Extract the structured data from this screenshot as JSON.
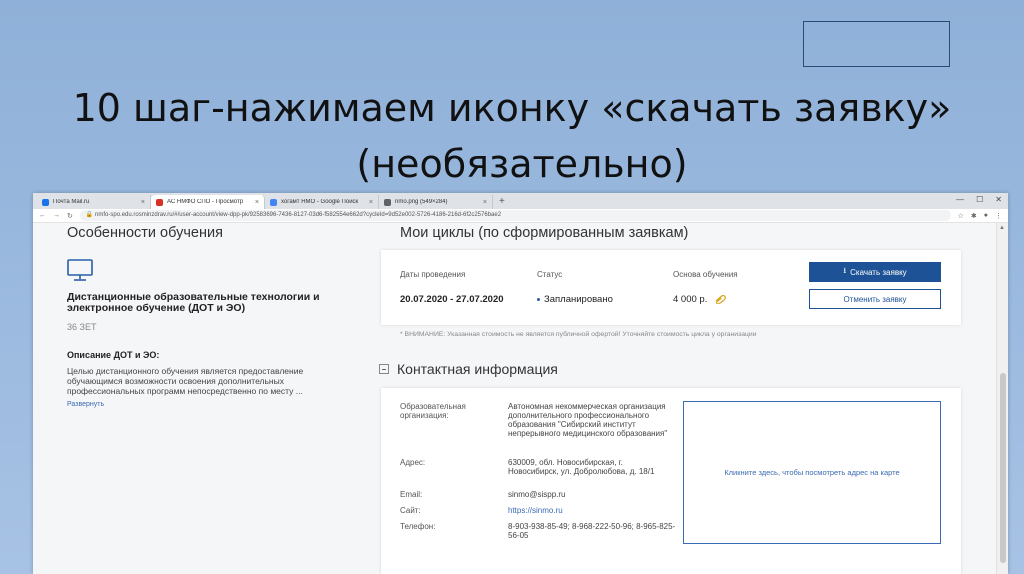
{
  "slide": {
    "title_line1": "10 шаг-нажимаем иконку «скачать заявку»",
    "title_line2": "(необязательно)"
  },
  "browser": {
    "tabs": [
      {
        "label": "Почта Mail.ru",
        "favicon_color": "#1a73e8",
        "active": false
      },
      {
        "label": "АС НМФО СПО - Просмотр",
        "favicon_color": "#d93025",
        "active": true
      },
      {
        "label": "хогамт НМО - Google Поиск",
        "favicon_color": "#4285f4",
        "active": false
      },
      {
        "label": "nmo.png (549×284)",
        "favicon_color": "#5f6368",
        "active": false
      }
    ],
    "new_tab": "+",
    "url": "nmfo-spo.edu.rosminzdrav.ru/#/user-account/view-dpp-pk/92583696-7436-8127-03d6-f582554e662d?cycleId=9d52e002-5726-4186-216d-6f2c2576bae2"
  },
  "left": {
    "features_heading": "Особенности обучения",
    "form_title": "Дистанционные образовательные технологии и электронное обучение (ДОТ и ЭО)",
    "form_zet": "36 ЗЕТ",
    "desc_title": "Описание ДОТ и ЭО:",
    "desc_text": "Целью дистанционного обучения является предоставление обучающимся возможности освоения дополнительных профессиональных программ непосредственно по месту ...",
    "expand": "Развернуть"
  },
  "cycles": {
    "heading": "Мои циклы (по сформированным заявкам)",
    "col_dates": "Даты проведения",
    "col_status": "Статус",
    "col_basis": "Основа обучения",
    "dates": "20.07.2020 - 27.07.2020",
    "status": "Запланировано",
    "basis": "4 000 р.",
    "download_button": "Скачать заявку",
    "cancel_button": "Отменить заявку",
    "notice": "* ВНИМАНИЕ: Указанная стоимость не является публичной офертой! Уточняйте стоимость цикла у организации"
  },
  "contact": {
    "heading": "Контактная информация",
    "org_label": "Образовательная организация:",
    "org_value": "Автономная некоммерческая организация дополнительного профессионального образования \"Сибирский институт непрерывного медицинского образования\"",
    "address_label": "Адрес:",
    "address_value": "630009, обл. Новосибирская, г. Новосибирск, ул. Добролюбова, д. 18/1",
    "email_label": "Email:",
    "email_value": "sinmo@sispp.ru",
    "site_label": "Сайт:",
    "site_value": "https://sinmo.ru",
    "phone_label": "Телефон:",
    "phone_value": "8-903-938-85-49; 8-968-222-50-96; 8-965-825-56-05",
    "map_text": "Кликните здесь, чтобы посмотреть адрес на карте"
  }
}
